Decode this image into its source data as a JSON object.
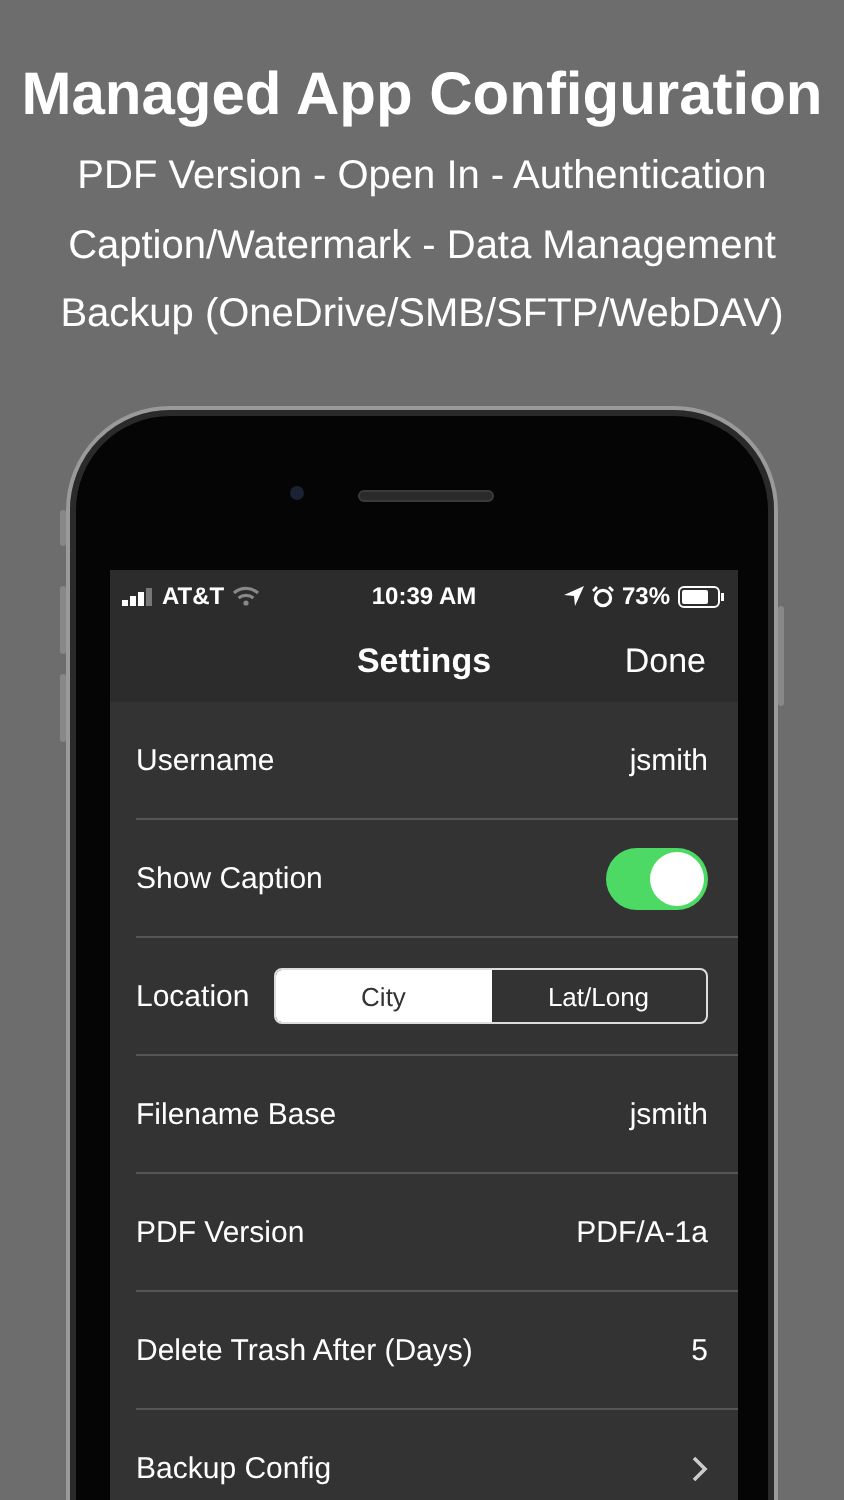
{
  "headline": {
    "title": "Managed App Configuration",
    "lines": [
      "PDF Version - Open In - Authentication",
      "Caption/Watermark - Data Management",
      "Backup (OneDrive/SMB/SFTP/WebDAV)"
    ]
  },
  "status_bar": {
    "carrier": "AT&T",
    "time": "10:39 AM",
    "battery": "73%"
  },
  "nav_bar": {
    "title": "Settings",
    "action": "Done"
  },
  "rows": [
    {
      "kind": "value",
      "label": "Username",
      "value": "jsmith"
    },
    {
      "kind": "toggle",
      "label": "Show Caption",
      "on": true
    },
    {
      "kind": "segmented",
      "label": "Location",
      "segments": [
        {
          "label": "City",
          "selected": true
        },
        {
          "label": "Lat/Long",
          "selected": false
        }
      ]
    },
    {
      "kind": "value",
      "label": "Filename Base",
      "value": "jsmith"
    },
    {
      "kind": "value",
      "label": "PDF Version",
      "value": "PDF/A-1a"
    },
    {
      "kind": "value",
      "label": "Delete Trash After (Days)",
      "value": "5"
    },
    {
      "kind": "disclosure",
      "label": "Backup Config"
    }
  ]
}
